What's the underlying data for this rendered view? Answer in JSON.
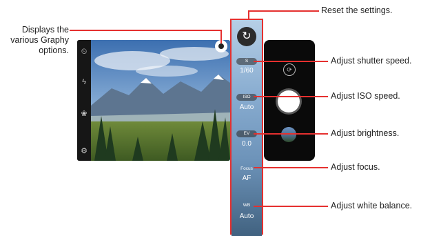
{
  "callouts": {
    "graphy_line1": "Displays the",
    "graphy_line2": "various Graphy",
    "graphy_line3": "options.",
    "reset": "Reset the settings.",
    "shutter": "Adjust shutter speed.",
    "iso": "Adjust ISO speed.",
    "brightness": "Adjust brightness.",
    "focus": "Adjust focus.",
    "white_balance": "Adjust white balance."
  },
  "settings": {
    "shutter_label": "S",
    "shutter_value": "1/60",
    "iso_label": "ISO",
    "iso_value": "Auto",
    "ev_label": "EV",
    "ev_value": "0.0",
    "focus_label": "Focus",
    "focus_value": "AF",
    "wb_label": "WB",
    "wb_value": "Auto"
  },
  "icons": {
    "timer": "timer-icon",
    "flash": "flash-off-icon",
    "filter": "filter-icon",
    "settings": "gear-icon",
    "graphy": "graphy-icon",
    "reset": "reset-icon",
    "switch_camera": "switch-camera-icon",
    "shutter": "shutter-button",
    "gallery": "gallery-thumbnail"
  },
  "colors": {
    "callout_line": "#e5302f"
  }
}
